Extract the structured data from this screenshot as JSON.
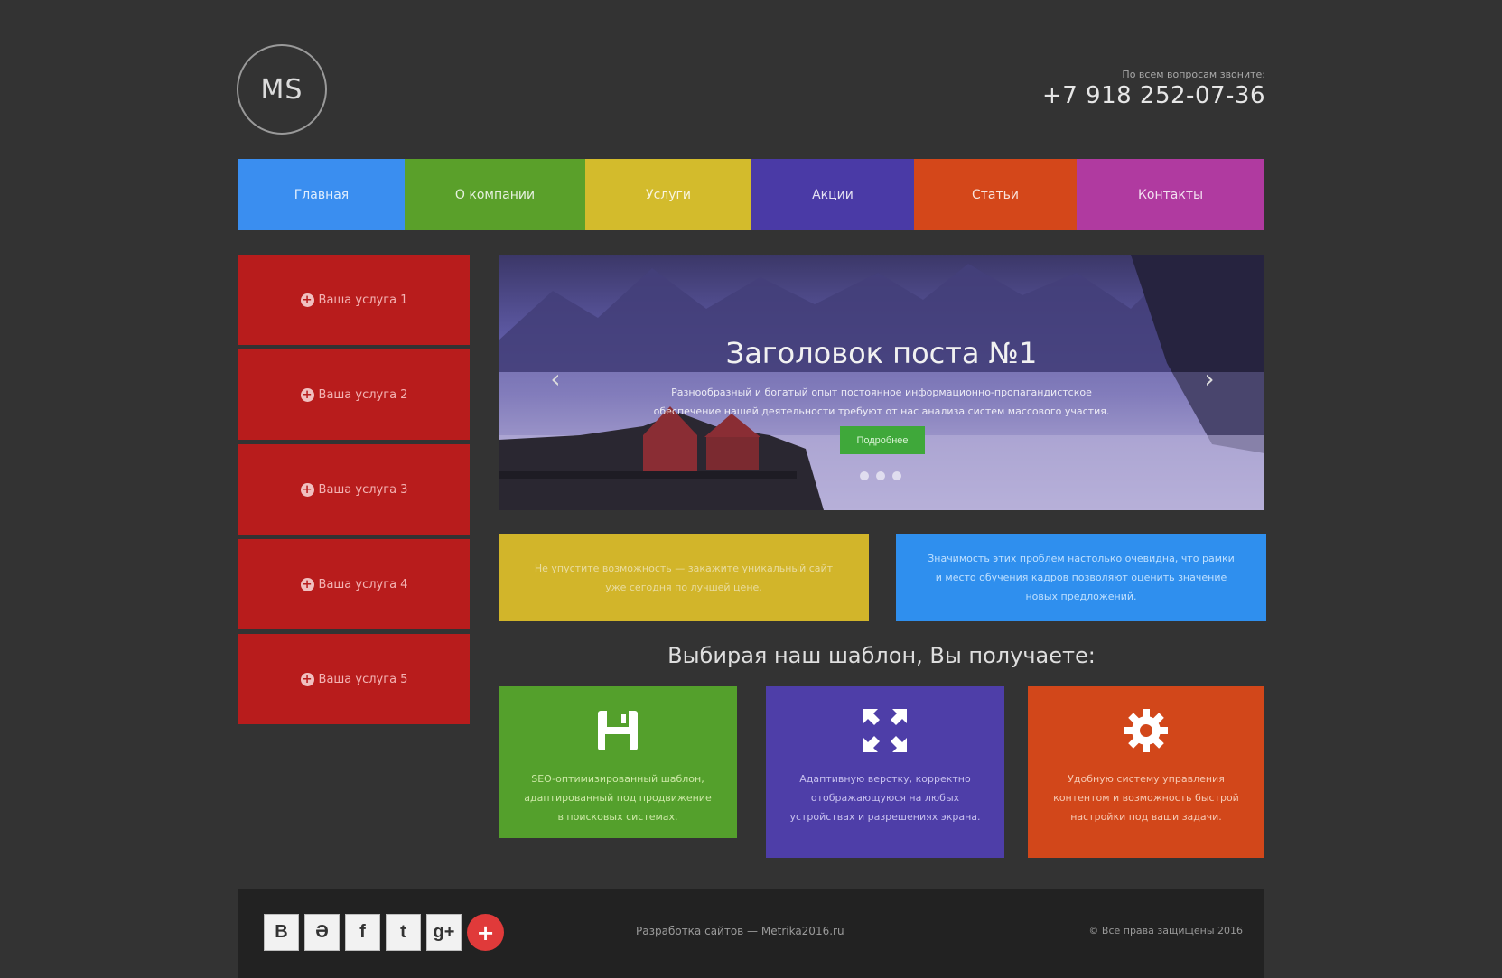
{
  "header": {
    "logo_text": "MS",
    "contact_label": "По всем вопросам звоните:",
    "phone": "+7 918 252-07-36"
  },
  "nav": {
    "items": [
      {
        "label": "Главная",
        "color": "#3a8ef0"
      },
      {
        "label": "О компании",
        "color": "#5aa02a"
      },
      {
        "label": "Услуги",
        "color": "#d3bb2c"
      },
      {
        "label": "Акции",
        "color": "#4a3aa6"
      },
      {
        "label": "Статьи",
        "color": "#d4471a"
      },
      {
        "label": "Контакты",
        "color": "#b03aa0"
      }
    ]
  },
  "sidebar": {
    "items": [
      {
        "label": "Ваша услуга 1"
      },
      {
        "label": "Ваша услуга 2"
      },
      {
        "label": "Ваша услуга 3"
      },
      {
        "label": "Ваша услуга 4"
      },
      {
        "label": "Ваша услуга 5"
      }
    ]
  },
  "slider": {
    "title": "Заголовок поста №1",
    "text": "Разнообразный и богатый опыт постоянное информационно-пропагандистское обеспечение нашей деятельности требуют от нас анализа систем массового участия.",
    "button_label": "Подробнее",
    "prev_icon": "chevron-left-icon",
    "next_icon": "chevron-right-icon"
  },
  "promos": {
    "yellow_text": "Не упустите возможность — закажите уникальный сайт уже сегодня по лучшей цене.",
    "blue_text": "Значимость этих проблем настолько очевидна, что рамки и место обучения кадров позволяют оценить значение новых предложений."
  },
  "features": {
    "heading": "Выбирая наш шаблон, Вы получаете:",
    "items": [
      {
        "icon": "save-icon",
        "text": "SEO-оптимизированный шаблон, адаптированный под продвижение в поисковых системах."
      },
      {
        "icon": "expand-icon",
        "text": "Адаптивную верстку, корректно отображающуюся на любых устройствах и разрешениях экрана."
      },
      {
        "icon": "gear-icon",
        "text": "Удобную систему управления контентом и возможность быстрой настройки под ваши задачи."
      }
    ]
  },
  "footer": {
    "socials": [
      {
        "name": "vk-icon",
        "glyph": "В"
      },
      {
        "name": "odnoklassniki-icon",
        "glyph": "Ә"
      },
      {
        "name": "facebook-icon",
        "glyph": "f"
      },
      {
        "name": "twitter-icon",
        "glyph": "t"
      },
      {
        "name": "google-plus-icon",
        "glyph": "g+"
      }
    ],
    "share_icon": "plus-icon",
    "center_link": "Разработка сайтов — Metrika2016.ru",
    "copyright": "© Все права защищены 2016"
  }
}
